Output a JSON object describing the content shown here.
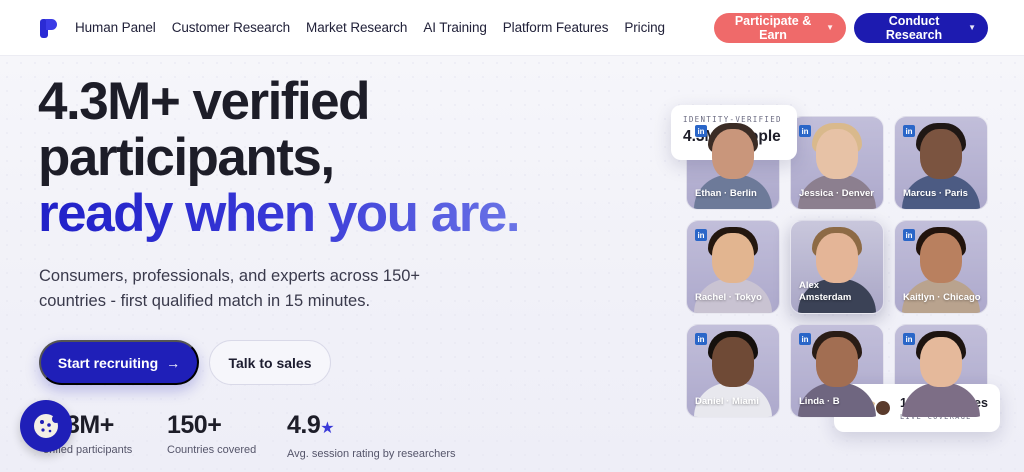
{
  "nav": {
    "items": [
      "Human Panel",
      "Customer Research",
      "Market Research",
      "AI Training",
      "Platform Features",
      "Pricing"
    ],
    "participate_label": "Participate & Earn",
    "conduct_label": "Conduct Research"
  },
  "hero": {
    "headline_line1": "4.3M+ verified",
    "headline_line2": "participants,",
    "headline_accent": "ready when you are.",
    "subtext": "Consumers, professionals, and experts across 150+ countries - first qualified match in 15 minutes.",
    "start_label": "Start recruiting",
    "start_arrow": "→",
    "sales_label": "Talk to sales"
  },
  "stats": [
    {
      "value": "3M+",
      "label": "erified participants"
    },
    {
      "value": "150+",
      "label": "Countries covered"
    },
    {
      "value": "4.9",
      "star": "★",
      "label": "Avg. session rating by researchers"
    }
  ],
  "identity_badge": {
    "small": "IDENTITY-VERIFIED",
    "big": "4.3M+ people"
  },
  "countries_badge": {
    "big": "150+ countries",
    "small": "LIVE COVERAGE"
  },
  "participants": [
    {
      "name": "Ethan · Berlin",
      "skin": "#c9967b",
      "hair": "#3b2c25",
      "shirt": "#6d7a99"
    },
    {
      "name": "Jessica · Denver",
      "skin": "#e7c2a6",
      "hair": "#d9b98c",
      "shirt": "#8c7f8f"
    },
    {
      "name": "Marcus · Paris",
      "skin": "#7b5440",
      "hair": "#1f1714",
      "shirt": "#4c5b83"
    },
    {
      "name": "Rachel · Tokyo",
      "skin": "#e2b590",
      "hair": "#23170f",
      "shirt": "#c9c3d2"
    },
    {
      "name": "Alex · Amsterdam",
      "skin": "#e4b597",
      "hair": "#8d6a45",
      "shirt": "#3b4256"
    },
    {
      "name": "Kaitlyn · Chicago",
      "skin": "#b9805f",
      "hair": "#22140d",
      "shirt": "#b9a38e"
    },
    {
      "name": "Daniel · Miami",
      "skin": "#6f4a36",
      "hair": "#15100d",
      "shirt": "#e8e8ee"
    },
    {
      "name": "Linda · B",
      "skin": "#a26e52",
      "hair": "#2a1c15",
      "shirt": "#6f6680"
    },
    {
      "name": "",
      "skin": "#e5b99b",
      "hair": "#1d1410",
      "shirt": "#7d6e86"
    }
  ],
  "colors": {
    "brand": "#1f1fb8",
    "participate": "#ef6a6a",
    "accent_gradient_end": "#6a74e6"
  }
}
